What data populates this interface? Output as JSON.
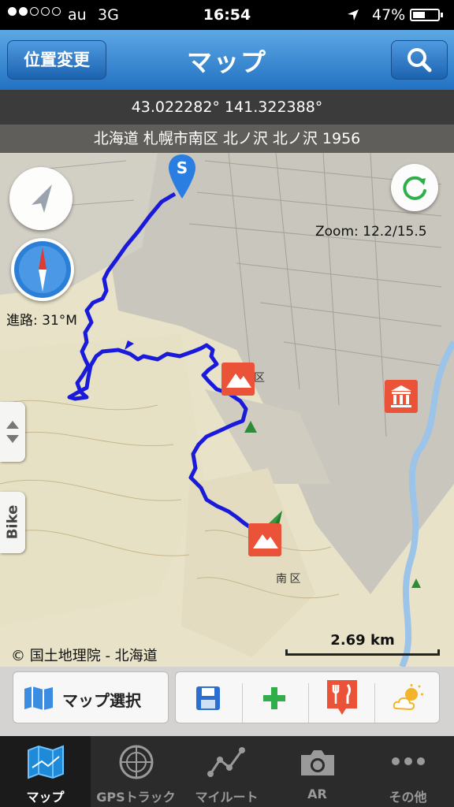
{
  "status_bar": {
    "carrier": "au",
    "network": "3G",
    "time": "16:54",
    "battery_percent": "47%",
    "signal_bars_filled": 2,
    "signal_bars_total": 5
  },
  "nav": {
    "title": "マップ",
    "left_button": "位置変更",
    "right_icon": "search-icon"
  },
  "coordinates": "43.022282° 141.322388°",
  "address": "北海道 札幌市南区 北ノ沢 北ノ沢 1956",
  "map": {
    "zoom_label": "Zoom: 12.2/15.5",
    "heading_label": "進路: 31°M",
    "start_marker": "S",
    "side_button_label": "Bike",
    "copyright": "© 国土地理院 - 北海道",
    "scale": "2.69 km",
    "district_label": "南 区",
    "district_label2": "区",
    "track_color": "#1a1adb"
  },
  "toolbar": {
    "map_select_label": "マップ選択",
    "icons": [
      "map-icon",
      "save-icon",
      "add-icon",
      "restaurant-icon",
      "weather-icon"
    ]
  },
  "tabs": [
    {
      "label": "マップ",
      "icon": "map-icon",
      "active": true
    },
    {
      "label": "GPSトラック",
      "icon": "radar-icon",
      "active": false
    },
    {
      "label": "マイルート",
      "icon": "route-icon",
      "active": false
    },
    {
      "label": "AR",
      "icon": "camera-icon",
      "active": false
    },
    {
      "label": "その他",
      "icon": "more-icon",
      "active": false
    }
  ]
}
